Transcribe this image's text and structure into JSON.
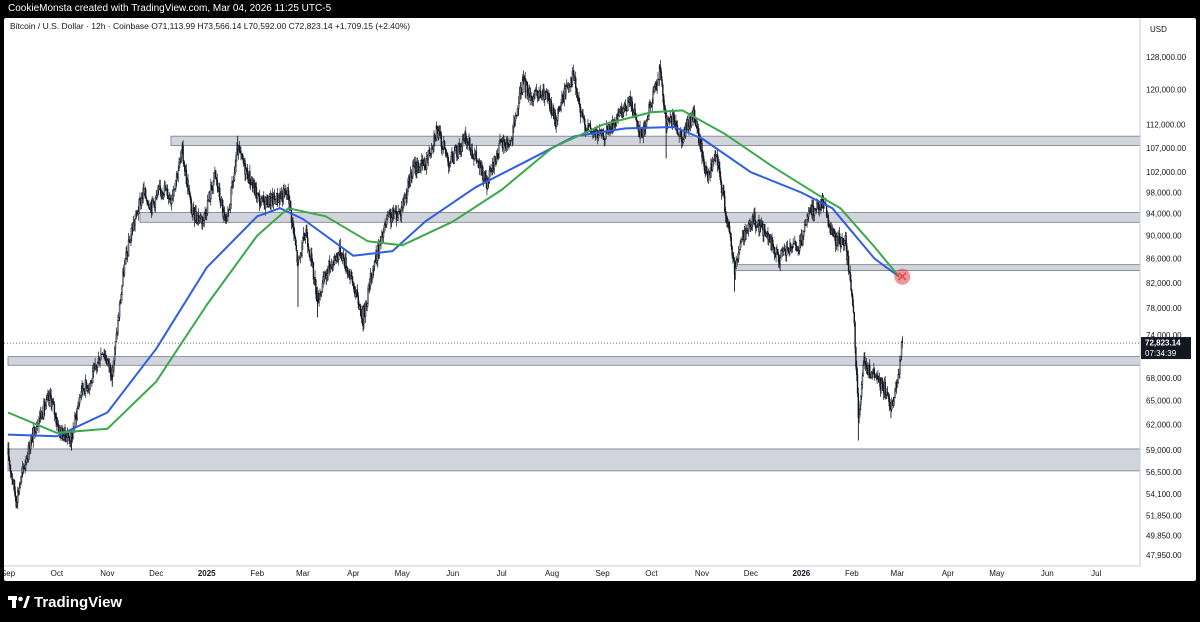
{
  "header": {
    "attribution": "CookieMonsta created with TradingView.com, Mar 04, 2026 11:25 UTC-5"
  },
  "legend": {
    "text": "Bitcoin / U.S. Dollar · 12h · Coinbase  O71,113.99  H73,566.14  L70,592.00  C72,823.14  +1,709.15 (+2.40%)"
  },
  "footer": {
    "brand": "TradingView",
    "logo_icon": "tradingview-logo-icon"
  },
  "chart_data": {
    "type": "candlestick",
    "currency_label": "USD",
    "y_axis_scale": "log",
    "y_ticks": [
      "128,000.00",
      "120,000.00",
      "112,000.00",
      "107,000.00",
      "102,000.00",
      "98,000.00",
      "94,000.00",
      "90,000.00",
      "86,000.00",
      "82,000.00",
      "78,000.00",
      "74,000.00",
      "68,000.00",
      "65,000.00",
      "62,000.00",
      "59,000.00",
      "56,500.00",
      "54,100.00",
      "51,850.00",
      "49,850.00",
      "47,950.00"
    ],
    "x_ticks": [
      "Sep",
      "Oct",
      "Nov",
      "Dec",
      "2025",
      "Feb",
      "Mar",
      "Apr",
      "May",
      "Jun",
      "Jul",
      "Aug",
      "Sep",
      "Oct",
      "Nov",
      "Dec",
      "2026",
      "Feb",
      "Mar",
      "Apr",
      "May",
      "Jun",
      "Jul"
    ],
    "bold_x_ticks": [
      "2025",
      "2026"
    ],
    "last_price": {
      "value": "72,823.14",
      "countdown": "07:34:39"
    },
    "price_path": [
      [
        "2024-09-01",
        58500
      ],
      [
        "2024-09-06",
        53500
      ],
      [
        "2024-09-12",
        58000
      ],
      [
        "2024-09-19",
        62500
      ],
      [
        "2024-09-27",
        65500
      ],
      [
        "2024-10-03",
        61000
      ],
      [
        "2024-10-10",
        60500
      ],
      [
        "2024-10-16",
        66500
      ],
      [
        "2024-10-22",
        67500
      ],
      [
        "2024-10-29",
        72000
      ],
      [
        "2024-11-04",
        68500
      ],
      [
        "2024-11-11",
        84000
      ],
      [
        "2024-11-16",
        91000
      ],
      [
        "2024-11-23",
        98000
      ],
      [
        "2024-11-28",
        95500
      ],
      [
        "2024-12-05",
        99000
      ],
      [
        "2024-12-10",
        97000
      ],
      [
        "2024-12-17",
        106000
      ],
      [
        "2024-12-23",
        94000
      ],
      [
        "2024-12-30",
        93000
      ],
      [
        "2025-01-06",
        101500
      ],
      [
        "2025-01-13",
        91500
      ],
      [
        "2025-01-20",
        106500
      ],
      [
        "2025-01-27",
        101000
      ],
      [
        "2025-02-03",
        96000
      ],
      [
        "2025-02-10",
        96500
      ],
      [
        "2025-02-20",
        98000
      ],
      [
        "2025-02-26",
        85000
      ],
      [
        "2025-03-03",
        91000
      ],
      [
        "2025-03-10",
        79500
      ],
      [
        "2025-03-17",
        84500
      ],
      [
        "2025-03-24",
        87500
      ],
      [
        "2025-03-31",
        82500
      ],
      [
        "2025-04-07",
        76500
      ],
      [
        "2025-04-13",
        84500
      ],
      [
        "2025-04-22",
        93000
      ],
      [
        "2025-04-30",
        94500
      ],
      [
        "2025-05-08",
        103000
      ],
      [
        "2025-05-15",
        103500
      ],
      [
        "2025-05-22",
        111000
      ],
      [
        "2025-05-30",
        104000
      ],
      [
        "2025-06-09",
        109000
      ],
      [
        "2025-06-15",
        105000
      ],
      [
        "2025-06-22",
        99500
      ],
      [
        "2025-06-30",
        107500
      ],
      [
        "2025-07-07",
        108500
      ],
      [
        "2025-07-14",
        122000
      ],
      [
        "2025-07-20",
        118000
      ],
      [
        "2025-07-28",
        119000
      ],
      [
        "2025-08-03",
        113000
      ],
      [
        "2025-08-10",
        121000
      ],
      [
        "2025-08-14",
        123500
      ],
      [
        "2025-08-19",
        113500
      ],
      [
        "2025-08-25",
        110500
      ],
      [
        "2025-09-01",
        109500
      ],
      [
        "2025-09-10",
        113000
      ],
      [
        "2025-09-18",
        117500
      ],
      [
        "2025-09-25",
        109500
      ],
      [
        "2025-10-01",
        117000
      ],
      [
        "2025-10-06",
        125000
      ],
      [
        "2025-10-10",
        112000
      ],
      [
        "2025-10-14",
        113000
      ],
      [
        "2025-10-20",
        109500
      ],
      [
        "2025-10-27",
        114500
      ],
      [
        "2025-11-04",
        101000
      ],
      [
        "2025-11-10",
        105000
      ],
      [
        "2025-11-17",
        92000
      ],
      [
        "2025-11-21",
        84500
      ],
      [
        "2025-11-26",
        90000
      ],
      [
        "2025-12-03",
        93000
      ],
      [
        "2025-12-10",
        90500
      ],
      [
        "2025-12-18",
        86000
      ],
      [
        "2025-12-24",
        87500
      ],
      [
        "2025-12-31",
        88000
      ],
      [
        "2026-01-06",
        94000
      ],
      [
        "2026-01-14",
        96500
      ],
      [
        "2026-01-21",
        89500
      ],
      [
        "2026-01-28",
        89000
      ],
      [
        "2026-02-02",
        77500
      ],
      [
        "2026-02-05",
        63000
      ],
      [
        "2026-02-08",
        70000
      ],
      [
        "2026-02-13",
        68500
      ],
      [
        "2026-02-20",
        67000
      ],
      [
        "2026-02-25",
        64500
      ],
      [
        "2026-03-01",
        67500
      ],
      [
        "2026-03-04",
        72823
      ]
    ],
    "wick_points": [
      [
        "2024-09-06",
        52600
      ],
      [
        "2024-10-10",
        58900
      ],
      [
        "2024-11-04",
        66800
      ],
      [
        "2024-12-17",
        108300
      ],
      [
        "2025-01-20",
        109600
      ],
      [
        "2025-02-26",
        78200
      ],
      [
        "2025-03-10",
        76600
      ],
      [
        "2025-04-07",
        74500
      ],
      [
        "2025-05-22",
        111900
      ],
      [
        "2025-06-22",
        98200
      ],
      [
        "2025-07-14",
        123200
      ],
      [
        "2025-08-14",
        124500
      ],
      [
        "2025-10-06",
        126200
      ],
      [
        "2025-10-10",
        104800
      ],
      [
        "2025-11-21",
        80600
      ],
      [
        "2026-01-14",
        97900
      ],
      [
        "2026-02-05",
        60100
      ],
      [
        "2026-02-25",
        62800
      ],
      [
        "2026-03-04",
        73566
      ]
    ],
    "moving_averages": [
      {
        "color": "#2f5fe0",
        "points": [
          [
            "2024-09-01",
            60800
          ],
          [
            "2024-10-01",
            60600
          ],
          [
            "2024-11-01",
            63500
          ],
          [
            "2024-12-01",
            72000
          ],
          [
            "2025-01-01",
            84500
          ],
          [
            "2025-02-01",
            93500
          ],
          [
            "2025-02-15",
            95000
          ],
          [
            "2025-03-01",
            93000
          ],
          [
            "2025-04-01",
            86500
          ],
          [
            "2025-04-25",
            87300
          ],
          [
            "2025-05-15",
            92500
          ],
          [
            "2025-06-15",
            99000
          ],
          [
            "2025-07-15",
            104000
          ],
          [
            "2025-08-15",
            109500
          ],
          [
            "2025-09-15",
            111200
          ],
          [
            "2025-10-15",
            111500
          ],
          [
            "2025-11-01",
            109000
          ],
          [
            "2025-12-01",
            102000
          ],
          [
            "2026-01-01",
            98000
          ],
          [
            "2026-01-20",
            95000
          ],
          [
            "2026-02-15",
            86000
          ],
          [
            "2026-03-02",
            83000
          ]
        ]
      },
      {
        "color": "#3ba84a",
        "points": [
          [
            "2024-09-01",
            63500
          ],
          [
            "2024-10-01",
            61000
          ],
          [
            "2024-11-01",
            61500
          ],
          [
            "2024-12-01",
            67500
          ],
          [
            "2025-01-01",
            78500
          ],
          [
            "2025-02-01",
            90000
          ],
          [
            "2025-02-20",
            95000
          ],
          [
            "2025-03-15",
            93500
          ],
          [
            "2025-04-10",
            89000
          ],
          [
            "2025-05-01",
            88300
          ],
          [
            "2025-06-01",
            92500
          ],
          [
            "2025-07-01",
            98500
          ],
          [
            "2025-08-01",
            107000
          ],
          [
            "2025-09-01",
            112000
          ],
          [
            "2025-10-01",
            114800
          ],
          [
            "2025-10-20",
            115200
          ],
          [
            "2025-11-15",
            110000
          ],
          [
            "2025-12-15",
            103000
          ],
          [
            "2026-01-15",
            96800
          ],
          [
            "2026-01-25",
            95000
          ],
          [
            "2026-02-15",
            88000
          ],
          [
            "2026-03-02",
            83000
          ]
        ]
      }
    ],
    "support_resistance_zones": [
      {
        "start": "2024-12-10",
        "low": 107500,
        "high": 109500
      },
      {
        "start": "2024-11-21",
        "low": 92400,
        "high": 94200
      },
      {
        "start": "2025-11-21",
        "low": 84000,
        "high": 85000
      },
      {
        "start": "2024-09-01",
        "low": 69700,
        "high": 70900
      },
      {
        "start": "2024-09-01",
        "low": 56600,
        "high": 59100
      }
    ],
    "dotted_price_line": 72823,
    "crossover_marker": {
      "date": "2026-03-04",
      "price": 83000,
      "symbol": "✕",
      "color": "#e0404a"
    }
  }
}
